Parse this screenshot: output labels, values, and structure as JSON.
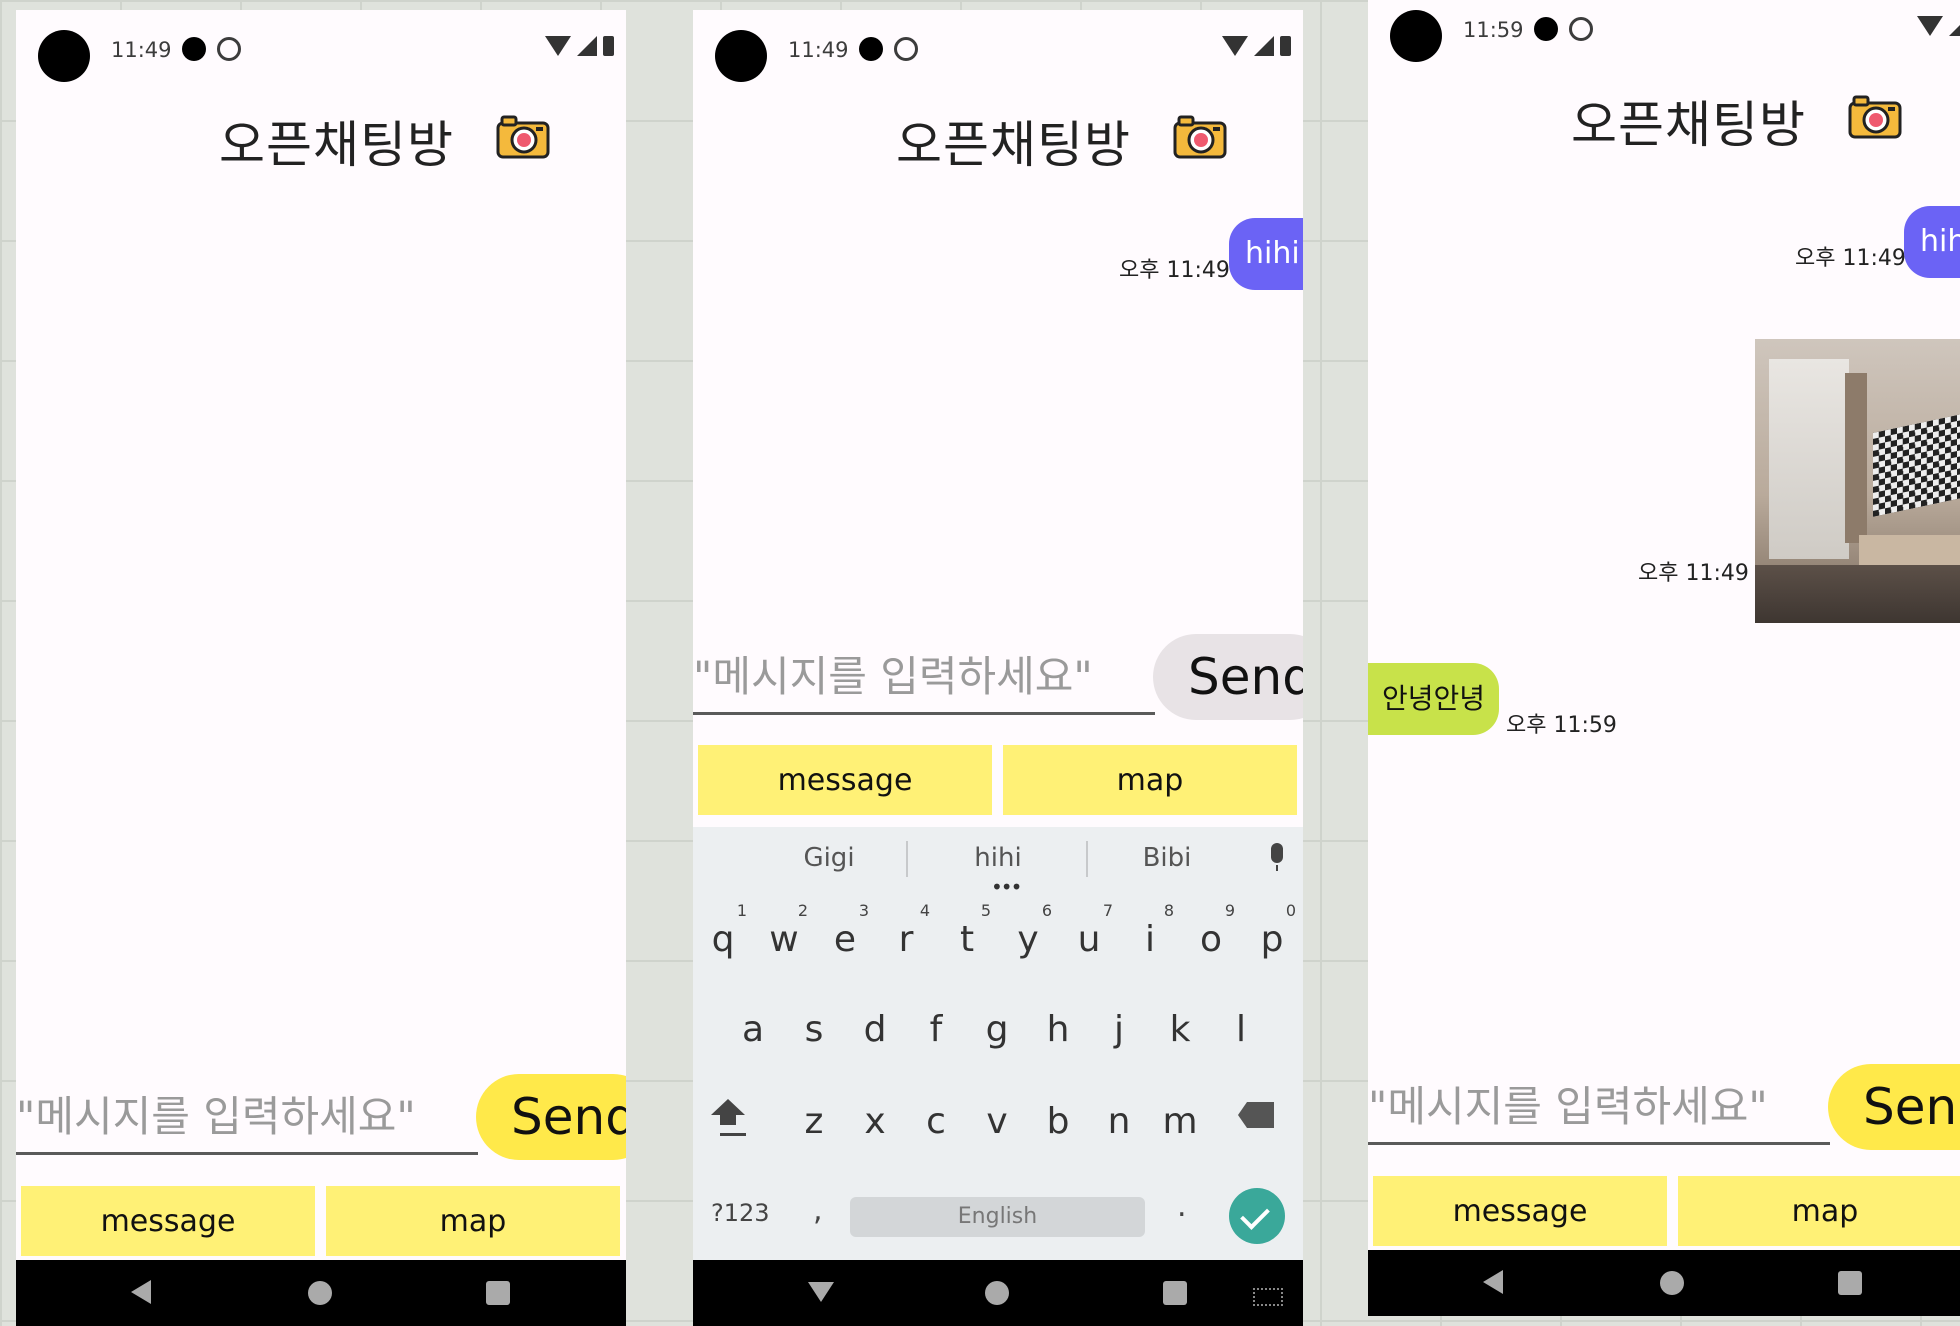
{
  "screens": [
    {
      "status": {
        "time": "11:49"
      },
      "title": "오픈채팅방",
      "input": {
        "placeholder": "\"메시지를 입력하세요\""
      },
      "send_label": "Send",
      "buttons": {
        "message": "message",
        "map": "map"
      }
    },
    {
      "status": {
        "time": "11:49"
      },
      "title": "오픈채팅방",
      "messages": [
        {
          "text": "hihi",
          "time": "오후 11:49"
        }
      ],
      "input": {
        "placeholder": "\"메시지를 입력하세요\""
      },
      "send_label": "Send",
      "buttons": {
        "message": "message",
        "map": "map"
      },
      "keyboard": {
        "suggestions": [
          "Gigi",
          "hihi",
          "Bibi"
        ],
        "row1": [
          {
            "k": "q",
            "n": "1"
          },
          {
            "k": "w",
            "n": "2"
          },
          {
            "k": "e",
            "n": "3"
          },
          {
            "k": "r",
            "n": "4"
          },
          {
            "k": "t",
            "n": "5"
          },
          {
            "k": "y",
            "n": "6"
          },
          {
            "k": "u",
            "n": "7"
          },
          {
            "k": "i",
            "n": "8"
          },
          {
            "k": "o",
            "n": "9"
          },
          {
            "k": "p",
            "n": "0"
          }
        ],
        "row2": [
          "a",
          "s",
          "d",
          "f",
          "g",
          "h",
          "j",
          "k",
          "l"
        ],
        "row3": [
          "z",
          "x",
          "c",
          "v",
          "b",
          "n",
          "m"
        ],
        "sym": "?123",
        "comma": ",",
        "space": "English",
        "period": "."
      }
    },
    {
      "status": {
        "time": "11:59"
      },
      "title": "오픈채팅방",
      "messages": [
        {
          "text": "hihi",
          "time": "오후 11:49"
        },
        {
          "image": true,
          "time": "오후 11:49"
        },
        {
          "text": "안녕안녕",
          "time": "오후 11:59"
        }
      ],
      "input": {
        "placeholder": "\"메시지를 입력하세요\""
      },
      "send_label": "Send",
      "buttons": {
        "message": "message",
        "map": "map"
      }
    }
  ],
  "colors": {
    "background": "#fffbfe",
    "send_yellow": "#ffe94a",
    "send_grey": "#e8e3e6",
    "button_yellow": "#fff176",
    "bubble_out": "#6b63f5",
    "bubble_in": "#c8e24a",
    "enter_key": "#3aa89a"
  },
  "icons": [
    "camera-icon",
    "wifi-icon",
    "signal-icon",
    "battery-icon",
    "back-icon",
    "home-icon",
    "recents-icon",
    "mic-icon",
    "shift-icon",
    "backspace-icon",
    "enter-icon"
  ]
}
